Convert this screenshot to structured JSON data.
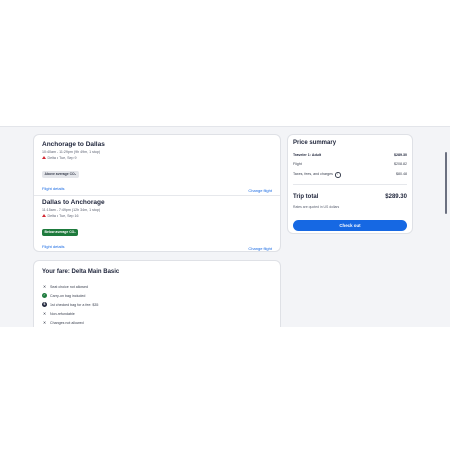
{
  "flights": [
    {
      "route": "Anchorage to Dallas",
      "times": "10:40am - 11:29pm (9h 49m, 1 stop)",
      "airline": "Delta • Tue, Sep 9",
      "badge": "Above average CO₂",
      "badge_color": "#e4e6ea",
      "details_link": "Flight details",
      "change_link": "Change flight"
    },
    {
      "route": "Dallas to Anchorage",
      "times": "11:15am - 7:49pm (12h 34m, 1 stop)",
      "airline": "Delta • Tue, Sep 16",
      "badge": "Below average CO₂",
      "badge_color": "#1d7a3c",
      "details_link": "Flight details",
      "change_link": "Change flight"
    }
  ],
  "fare": {
    "title": "Your fare: Delta Main Basic",
    "items": [
      {
        "icon": "x-icon",
        "text": "Seat choice not allowed"
      },
      {
        "icon": "check-circle-icon",
        "text": "Carry-on bag included"
      },
      {
        "icon": "dollar-circle-icon",
        "text": "1st checked bag for a fee: $35"
      },
      {
        "icon": "x-icon",
        "text": "Non-refundable"
      },
      {
        "icon": "x-icon",
        "text": "Changes not allowed"
      }
    ]
  },
  "summary": {
    "title": "Price summary",
    "traveler_label": "Traveler 1: Adult",
    "traveler_price": "$289.30",
    "flight_label": "Flight",
    "flight_price": "$208.82",
    "taxes_label": "Taxes, fees, and charges",
    "taxes_price": "$80.48",
    "total_label": "Trip total",
    "total_price": "$289.30",
    "rates_note": "Rates are quoted in US dollars",
    "checkout_label": "Check out"
  },
  "colors": {
    "accent": "#1668e3",
    "delta_red": "#d22630",
    "eco_green": "#1d7a3c"
  }
}
